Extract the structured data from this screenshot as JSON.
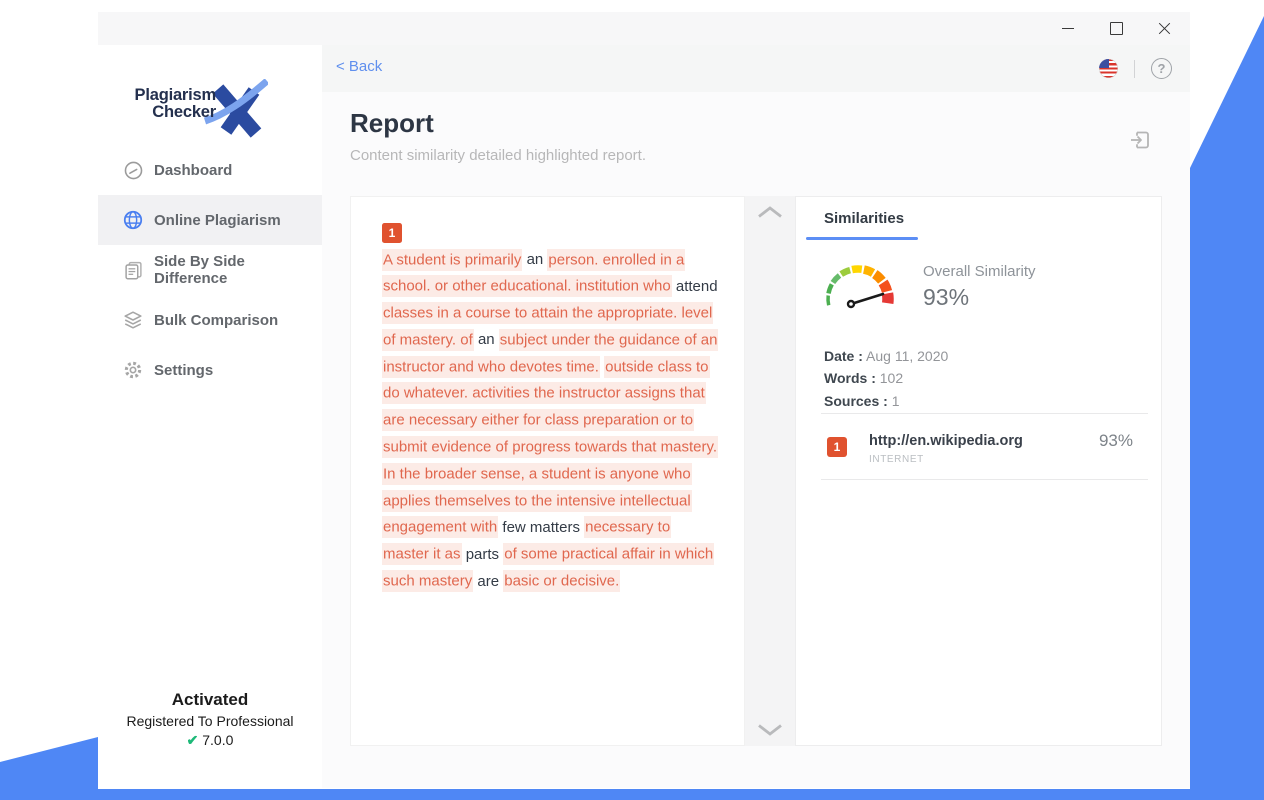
{
  "app": {
    "logo": {
      "line1": "Plagiarism",
      "line2": "Checker",
      "mark": "X"
    },
    "activation": {
      "status": "Activated",
      "registered": "Registered To Professional",
      "check_glyph": "✔",
      "version": "7.0.0"
    }
  },
  "window_title_buttons": {
    "minimize": "minimize",
    "maximize": "maximize",
    "close": "close"
  },
  "sidebar": {
    "items": [
      {
        "label": "Dashboard",
        "icon": "dashboard-icon",
        "active": false
      },
      {
        "label": "Online Plagiarism",
        "icon": "globe-icon",
        "active": true
      },
      {
        "label": "Side By Side Difference",
        "icon": "side-by-side-document-icon",
        "active": false
      },
      {
        "label": "Bulk Comparison",
        "icon": "layers-icon",
        "active": false
      },
      {
        "label": "Settings",
        "icon": "gear-icon",
        "active": false
      }
    ]
  },
  "topbar": {
    "back_label": "< Back",
    "help_glyph": "?",
    "language_icon": "us-flag-icon"
  },
  "header": {
    "title": "Report",
    "subtitle": "Content similarity detailed highlighted report.",
    "export_icon": "export-icon"
  },
  "document": {
    "source_badge": "1",
    "segments": [
      {
        "text": "A student is primarily",
        "highlighted": true
      },
      {
        "text": "an",
        "highlighted": false
      },
      {
        "text": "person. enrolled in a school. or other educational. institution who",
        "highlighted": true
      },
      {
        "text": "attend",
        "highlighted": false
      },
      {
        "text": "classes in a course to attain the appropriate. level of mastery. of",
        "highlighted": true
      },
      {
        "text": "an",
        "highlighted": false
      },
      {
        "text": "subject under the guidance of an instructor and who devotes time.",
        "highlighted": true
      },
      {
        "text": "outside class to do whatever. activities the instructor assigns that are necessary either for class preparation or to submit evidence of progress towards that mastery.",
        "highlighted": true
      },
      {
        "text": "In the broader sense, a student is anyone who applies themselves to the intensive intellectual engagement with",
        "highlighted": true
      },
      {
        "text": "few matters",
        "highlighted": false
      },
      {
        "text": "necessary to master it as",
        "highlighted": true
      },
      {
        "text": "parts",
        "highlighted": false
      },
      {
        "text": "of some practical affair in which such mastery",
        "highlighted": true
      },
      {
        "text": "are",
        "highlighted": false
      },
      {
        "text": "basic or decisive.",
        "highlighted": true
      }
    ]
  },
  "similarities": {
    "tab_label": "Similarities",
    "overall_label": "Overall Similarity",
    "overall_value": "93%",
    "meta": [
      {
        "label": "Date :",
        "value": "Aug 11, 2020"
      },
      {
        "label": "Words :",
        "value": "102"
      },
      {
        "label": "Sources :",
        "value": "1"
      }
    ],
    "sources": [
      {
        "badge": "1",
        "url": "http://en.wikipedia.org",
        "type": "INTERNET",
        "percent": "93%"
      }
    ]
  },
  "colors": {
    "background_blue": "#4F87F5",
    "back_link_blue": "#5f8fee",
    "tab_underline_blue": "#5c8ef5",
    "highlight_bg": "#fcebe6",
    "highlight_text": "#e0674e",
    "badge_orange": "#e0522f",
    "check_green": "#1db978",
    "gauge": [
      "#4caf50",
      "#4caf50",
      "#66bb6a",
      "#9ccc3c",
      "#ffd600",
      "#ffb300",
      "#fb8c00",
      "#f4511e",
      "#e53935"
    ]
  }
}
